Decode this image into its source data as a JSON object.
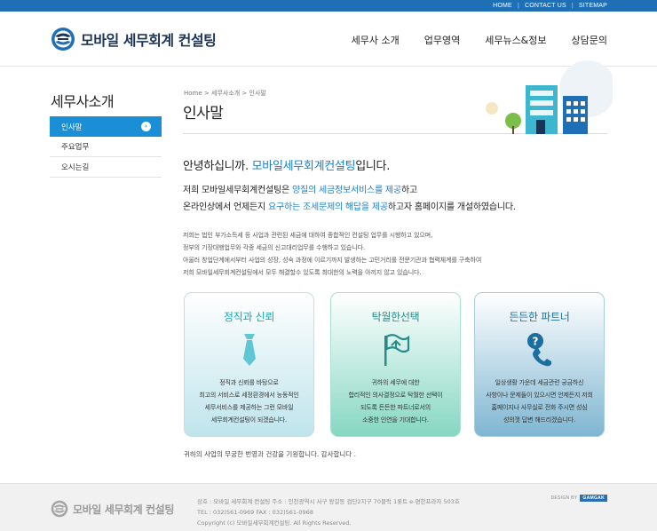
{
  "topbar": {
    "links": [
      "HOME",
      "CONTACT US",
      "SITEMAP"
    ]
  },
  "header": {
    "logo_text": "모바일 세무회계 컨설팅",
    "nav": [
      "세무사 소개",
      "업무영역",
      "세무뉴스&정보",
      "상담문의"
    ]
  },
  "sidebar": {
    "title": "세무사소개",
    "items": [
      {
        "label": "인사말",
        "active": true
      },
      {
        "label": "주요업무",
        "active": false
      },
      {
        "label": "오시는길",
        "active": false
      }
    ]
  },
  "breadcrumb": [
    "Home",
    "세무사소개",
    "인사말"
  ],
  "page_title": "인사말",
  "greeting": {
    "before": "안녕하십니까. ",
    "highlight": "모바일세무회계컨설팅",
    "after": "입니다."
  },
  "lead": {
    "line1_a": "저희 모바일세무회계컨설팅은 ",
    "line1_hl": "양질의 세금정보서비스를 제공",
    "line1_b": "하고",
    "line2_a": "온라인상에서 언제든지 ",
    "line2_hl": "요구하는 조세문제의 해답을 제공",
    "line2_b": "하고자 홈페이지를 개설하였습니다."
  },
  "body_lines": [
    "저희는 법인 부가소득세 등 사업과 관련된 세금에 대하여 종합적인 컨설팅 업무를 시행하고 있으며,",
    "정부의 기장대행업무와 각종 세금의 신고대리업무를 수행하고 있습니다.",
    "아울러 창업단계에서부터 사업의 성장, 성숙 과정에 이르기까지 발생하는 고민거리를 전문기관과 협력체계를 구축하여",
    "저희 모바일세무회계컨설팅에서 모두 해결할수 있도록 최대한의 노력을 아끼지 않고 있습니다."
  ],
  "cards": [
    {
      "title": "정직과 신뢰",
      "icon": "necktie-icon",
      "lines": [
        "정직과 신뢰를 바탕으로",
        "최고의 서비스로 세정환경에서 능동적인",
        "세무서비스를 제공하는 그런 모바일",
        "세무회계컨설팅이 되겠습니다."
      ]
    },
    {
      "title": "탁월한선택",
      "icon": "flag-icon",
      "lines": [
        "귀하의 세무에 대한",
        "합리적인 의사결정으로 탁월한 선택이",
        "되도록 든든한 파트너로서의",
        "소중한 인연을 기대합니다."
      ]
    },
    {
      "title": "든든한 파트너",
      "icon": "phone-question-icon",
      "lines": [
        "일상생활 가운데 세금관련 궁금하신",
        "사항이나 문제들이 있으시면 언제든지 저희",
        "홈페이지나 사무실로 전화 주시면 성심",
        "성의껏 답변 해드리겠습니다."
      ]
    }
  ],
  "closing": "귀하의 사업의 무궁한 번영과 건강을 기원합니다. 감사합니다 .",
  "footer": {
    "logo_text": "모바일 세무회계 컨설팅",
    "line1": "상호 : 모바일 세무회계 컨설팅  주소 : 인천광역시 서구 왕길동 검단2지구 70블럭 1롯트 e-편한프라자 503호",
    "line2": "TEL : 032)561-0969  FAX : 032)561-0968",
    "line3": "Copyright (c) 모바일세무회계컨설팅.  All Rights Reserved.",
    "design_by": "DESIGN BY",
    "design_badge": "GAMGAK"
  },
  "colors": {
    "primary": "#1e6fb5",
    "accent": "#1b8fd6",
    "highlight": "#1a7fc7",
    "navy": "#1c3557"
  }
}
